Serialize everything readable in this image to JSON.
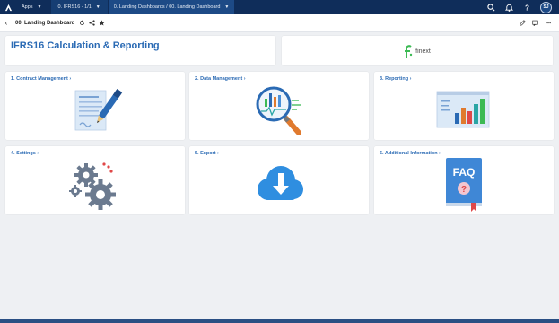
{
  "topbar": {
    "apps_label": "Apps",
    "module_label": "0. IFRS16 - 1/1",
    "breadcrumb_label": "0. Landing Dashboards / 00. Landing Dashboard",
    "avatar_initials": "SJ"
  },
  "subbar": {
    "page_title": "00. Landing Dashboard"
  },
  "header": {
    "title": "IFRS16 Calculation & Reporting",
    "brand_name": "finext"
  },
  "tiles": [
    {
      "label": "1. Contract Management",
      "icon": "contract-document-icon"
    },
    {
      "label": "2. Data Management",
      "icon": "magnifier-chart-icon"
    },
    {
      "label": "3. Reporting",
      "icon": "bar-chart-icon"
    },
    {
      "label": "4. Settings",
      "icon": "gears-icon"
    },
    {
      "label": "5. Export",
      "icon": "cloud-download-icon"
    },
    {
      "label": "6. Additional Information",
      "icon": "faq-book-icon"
    }
  ],
  "colors": {
    "topbar": "#0f2d5a",
    "accent": "#2a6ab4",
    "brand_green": "#3cba54"
  }
}
